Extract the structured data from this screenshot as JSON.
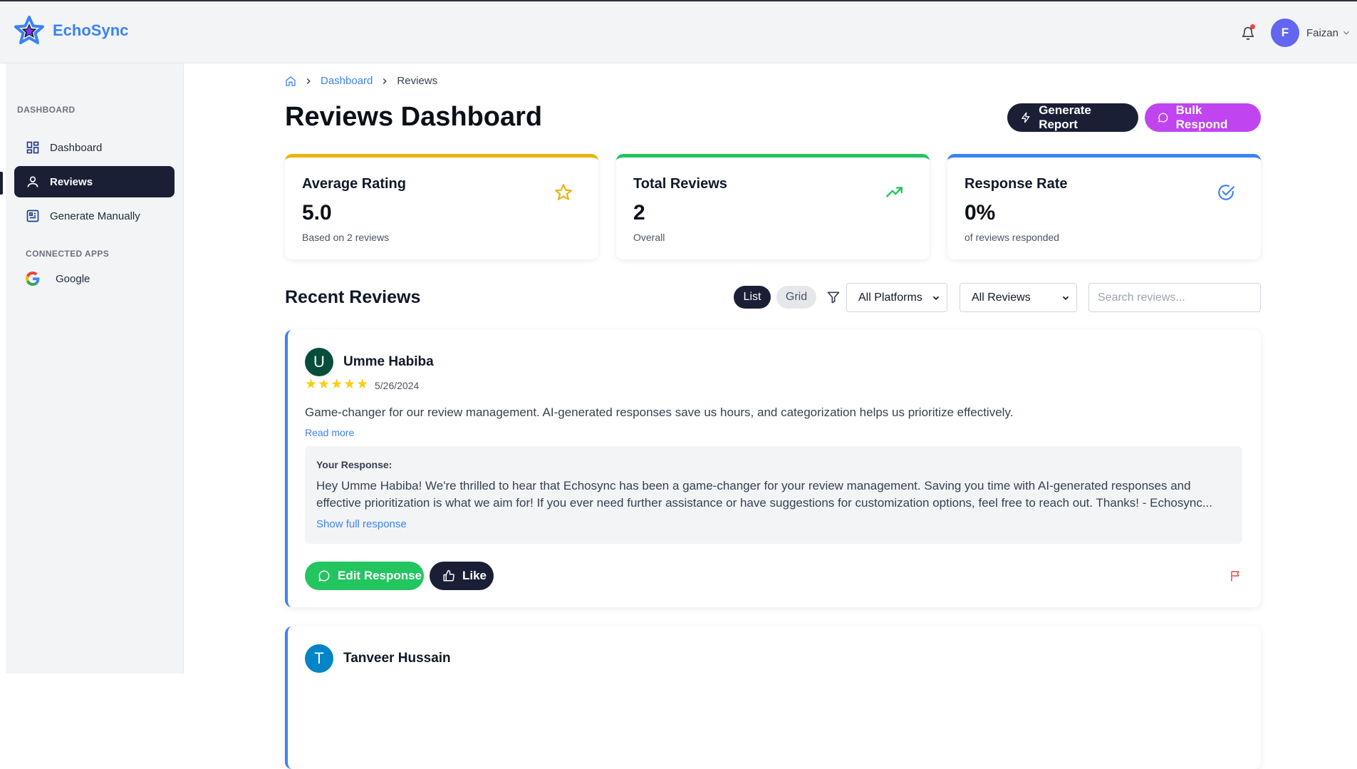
{
  "app": {
    "name": "EchoSync"
  },
  "user": {
    "initial": "F",
    "name": "Faizan"
  },
  "sidebar": {
    "section_label": "DASHBOARD",
    "items": [
      {
        "label": "Dashboard",
        "icon": "dashboard-icon"
      },
      {
        "label": "Reviews",
        "icon": "user-icon",
        "active": true
      },
      {
        "label": "Generate Manually",
        "icon": "generate-icon"
      }
    ],
    "connected_label": "CONNECTED APPS",
    "apps": [
      {
        "label": "Google",
        "icon": "google-icon"
      }
    ]
  },
  "breadcrumb": {
    "home_icon": "home-icon",
    "link": "Dashboard",
    "current": "Reviews"
  },
  "page": {
    "title": "Reviews Dashboard"
  },
  "actions": {
    "generate_report": "Generate Report",
    "bulk_respond": "Bulk Respond"
  },
  "stats": [
    {
      "title": "Average Rating",
      "value": "5.0",
      "sub": "Based on 2 reviews",
      "color": "#eab308",
      "icon": "star-icon"
    },
    {
      "title": "Total Reviews",
      "value": "2",
      "sub": "Overall",
      "color": "#22c55e",
      "icon": "trending-up-icon"
    },
    {
      "title": "Response Rate",
      "value": "0%",
      "sub": "of reviews responded",
      "color": "#3b82f6",
      "icon": "check-circle-icon"
    }
  ],
  "recent": {
    "title": "Recent Reviews",
    "view_list": "List",
    "view_grid": "Grid",
    "platform_filter": "All Platforms",
    "review_filter": "All Reviews",
    "search_placeholder": "Search reviews..."
  },
  "reviews": [
    {
      "initial": "U",
      "avatar_color": "#064e3b",
      "name": "Umme Habiba",
      "rating": 5,
      "date": "5/26/2024",
      "text": "Game-changer for our review management. AI-generated responses save us hours, and categorization helps us prioritize effectively.",
      "read_more": "Read more",
      "response_label": "Your Response:",
      "response": "Hey Umme Habiba! We're thrilled to hear that Echosync has been a game-changer for your review management. Saving you time with AI-generated responses and effective prioritization is what we aim for! If you ever need further assistance or have suggestions for customization options, feel free to reach out. Thanks! - Echosync...",
      "show_full": "Show full response",
      "edit_label": "Edit Response",
      "like_label": "Like"
    },
    {
      "initial": "T",
      "avatar_color": "#0284c7",
      "name": "Tanveer Hussain"
    }
  ]
}
